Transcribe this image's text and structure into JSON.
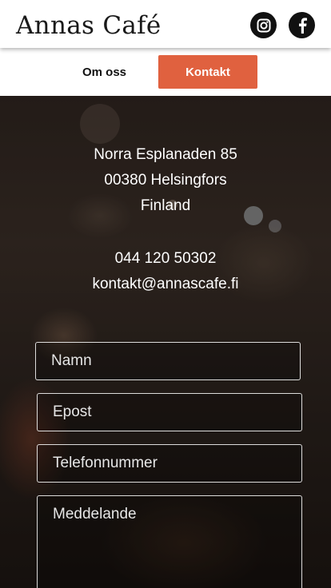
{
  "header": {
    "brand": "Annas Café",
    "social": [
      {
        "name": "instagram-icon"
      },
      {
        "name": "facebook-icon"
      }
    ]
  },
  "nav": {
    "about": "Om oss",
    "contact": "Kontakt"
  },
  "colors": {
    "accent": "#e0613f",
    "header_bg": "#ffffff",
    "text_on_dark": "#ffffff"
  },
  "contact": {
    "street": "Norra Esplanaden 85",
    "postal_city": "00380 Helsingfors",
    "country": "Finland",
    "phone": "044 120 50302",
    "email": "kontakt@annascafe.fi"
  },
  "form": {
    "name_placeholder": "Namn",
    "email_placeholder": "Epost",
    "phone_placeholder": "Telefonnummer",
    "message_placeholder": "Meddelande"
  }
}
